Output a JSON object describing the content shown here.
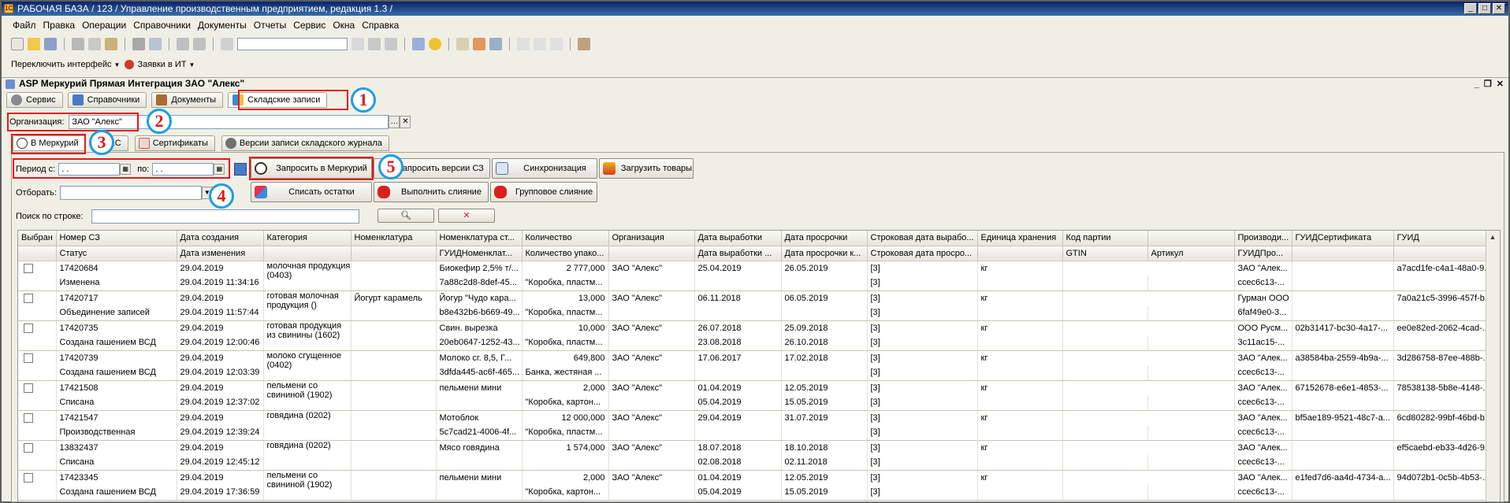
{
  "window": {
    "title": "РАБОЧАЯ БАЗА / 123 / Управление производственным предприятием, редакция 1.3 /"
  },
  "menu": [
    "Файл",
    "Правка",
    "Операции",
    "Справочники",
    "Документы",
    "Отчеты",
    "Сервис",
    "Окна",
    "Справка"
  ],
  "toolbar2": {
    "switch_interface": "Переключить интерфейс",
    "requests": "Заявки в ИТ"
  },
  "document": {
    "title": "ASP Меркурий Прямая Интеграция ЗАО \"Алекс\""
  },
  "section_tabs": [
    "Сервис",
    "Справочники",
    "Документы",
    "Складские записи"
  ],
  "org": {
    "label": "Организация:",
    "value": "ЗАО \"Алекс\""
  },
  "sub_tabs": [
    "В Меркурий",
    "1С",
    "Сертификаты",
    "Версии записи складского журнала"
  ],
  "filters": {
    "period_from_label": "Период с:",
    "period_from_value": ". .",
    "period_to_label": "по:",
    "period_to_value": ". .",
    "select_label": "Отборать:",
    "search_label": "Поиск по строке:"
  },
  "buttons": {
    "request_mercury": "Запросить в Меркурий",
    "request_versions": "Запросить версии СЗ",
    "sync": "Синхронизация",
    "load_goods": "Загрузить товары",
    "write_off": "Списать остатки",
    "merge": "Выполнить слияние",
    "group_merge": "Групповое слияние"
  },
  "annotations": [
    "1",
    "2",
    "3",
    "4",
    "5"
  ],
  "table": {
    "headers1": [
      "Выбран",
      "Номер СЗ",
      "Дата создания",
      "Категория",
      "Номенклатура",
      "Номенклатура ст...",
      "Количество",
      "Организация",
      "Дата выработки",
      "Дата просрочки",
      "Строковая дата вырабо...",
      "Единица хранения",
      "Код партии",
      "",
      "Производи...",
      "ГУИДСертификата",
      "ГУИД"
    ],
    "headers2": [
      "",
      "Статус",
      "Дата изменения",
      "",
      "",
      "ГУИДНоменклат...",
      "Количество упако...",
      "",
      "Дата выработки ...",
      "Дата просрочки к...",
      "Строковая дата просро...",
      "",
      "GTIN",
      "Артикул",
      "ГУИДПро...",
      "",
      ""
    ],
    "rows": [
      {
        "num": "17420684",
        "status": "Изменена",
        "created": "29.04.2019",
        "changed": "29.04.2019 11:34:16",
        "category": "молочная продукция (0403)",
        "nomen": "",
        "nomst": "Биокефир 2,5% т/...",
        "guidn": "7a88c2d8-8def-45...",
        "qty": "2 777,000",
        "pack": "\"Коробка, пластм...",
        "org": "ЗАО \"Алекс\"",
        "prod1": "25.04.2019",
        "prod2": "",
        "exp1": "26.05.2019",
        "exp2": "",
        "str1": "[3]",
        "str2": "[3]",
        "unit": "кг",
        "maker": "ЗАО \"Алек...",
        "guidp": "ccec6c13-...",
        "cert": "",
        "guid": "a7acd1fe-c4a1-48a0-9..."
      },
      {
        "num": "17420717",
        "status": "Объединение записей",
        "created": "29.04.2019",
        "changed": "29.04.2019 11:57:44",
        "category": "готовая молочная продукция ()",
        "nomen": "Йогурт карамель",
        "nomst": "Йогур \"Чудо кара...",
        "guidn": "b8e432b6-b669-49...",
        "qty": "13,000",
        "pack": "\"Коробка, пластм...",
        "org": "ЗАО \"Алекс\"",
        "prod1": "06.11.2018",
        "prod2": "",
        "exp1": "06.05.2019",
        "exp2": "",
        "str1": "[3]",
        "str2": "[3]",
        "unit": "кг",
        "maker": "Гурман ООО",
        "guidp": "6faf49e0-3...",
        "cert": "",
        "guid": "7a0a21c5-3996-457f-b..."
      },
      {
        "num": "17420735",
        "status": "Создана гашением ВСД",
        "created": "29.04.2019",
        "changed": "29.04.2019 12:00:46",
        "category": "готовая продукция из свинины (1602)",
        "nomen": "",
        "nomst": "Свин. вырезка",
        "guidn": "20eb0647-1252-43...",
        "qty": "10,000",
        "pack": "\"Коробка, пластм...",
        "org": "ЗАО \"Алекс\"",
        "prod1": "26.07.2018",
        "prod2": "23.08.2018",
        "exp1": "25.09.2018",
        "exp2": "26.10.2018",
        "str1": "[3]",
        "str2": "[3]",
        "unit": "кг",
        "maker": "ООО Русм...",
        "guidp": "3c11ac15-...",
        "cert": "02b31417-bc30-4a17-...",
        "guid": "ee0e82ed-2062-4cad-..."
      },
      {
        "num": "17420739",
        "status": "Создана гашением ВСД",
        "created": "29.04.2019",
        "changed": "29.04.2019 12:03:39",
        "category": "молоко сгущенное (0402)",
        "nomen": "",
        "nomst": "Молоко сг. 8,5, Г...",
        "guidn": "3dfda445-ac6f-465...",
        "qty": "649,800",
        "pack": "Банка, жестяная ...",
        "org": "ЗАО \"Алекс\"",
        "prod1": "17.06.2017",
        "prod2": "",
        "exp1": "17.02.2018",
        "exp2": "",
        "str1": "[3]",
        "str2": "[3]",
        "unit": "кг",
        "maker": "ЗАО \"Алек...",
        "guidp": "ccec6c13-...",
        "cert": "a38584ba-2559-4b9a-...",
        "guid": "3d286758-87ee-488b-..."
      },
      {
        "num": "17421508",
        "status": "Списана",
        "created": "29.04.2019",
        "changed": "29.04.2019 12:37:02",
        "category": "пельмени со свининой (1902)",
        "nomen": "",
        "nomst": "пельмени мини",
        "guidn": "",
        "qty": "2,000",
        "pack": "\"Коробка, картон...",
        "org": "ЗАО \"Алекс\"",
        "prod1": "01.04.2019",
        "prod2": "05.04.2019",
        "exp1": "12.05.2019",
        "exp2": "15.05.2019",
        "str1": "[3]",
        "str2": "[3]",
        "unit": "кг",
        "maker": "ЗАО \"Алек...",
        "guidp": "ccec6c13-...",
        "cert": "67152678-e6e1-4853-...",
        "guid": "78538138-5b8e-4148-..."
      },
      {
        "num": "17421547",
        "status": "Производственная",
        "created": "29.04.2019",
        "changed": "29.04.2019 12:39:24",
        "category": "говядина (0202)",
        "nomen": "",
        "nomst": "Мотоблок",
        "guidn": "5c7cad21-4006-4f...",
        "qty": "12 000,000",
        "pack": "\"Коробка, пластм...",
        "org": "ЗАО \"Алекс\"",
        "prod1": "29.04.2019",
        "prod2": "",
        "exp1": "31.07.2019",
        "exp2": "",
        "str1": "[3]",
        "str2": "[3]",
        "unit": "кг",
        "maker": "ЗАО \"Алек...",
        "guidp": "ccec6c13-...",
        "cert": "bf5ae189-9521-48c7-a...",
        "guid": "6cd80282-99bf-46bd-b..."
      },
      {
        "num": "13832437",
        "status": "Списана",
        "created": "29.04.2019",
        "changed": "29.04.2019 12:45:12",
        "category": "говядина (0202)",
        "nomen": "",
        "nomst": "Мясо говядина",
        "guidn": "",
        "qty": "1 574,000",
        "pack": "",
        "org": "ЗАО \"Алекс\"",
        "prod1": "18.07.2018",
        "prod2": "02.08.2018",
        "exp1": "18.10.2018",
        "exp2": "02.11.2018",
        "str1": "[3]",
        "str2": "[3]",
        "unit": "кг",
        "maker": "ЗАО \"Алек...",
        "guidp": "ccec6c13-...",
        "cert": "",
        "guid": "ef5caebd-eb33-4d26-9..."
      },
      {
        "num": "17423345",
        "status": "Создана гашением ВСД",
        "created": "29.04.2019",
        "changed": "29.04.2019 17:36:59",
        "category": "пельмени со свининой (1902)",
        "nomen": "",
        "nomst": "пельмени мини",
        "guidn": "",
        "qty": "2,000",
        "pack": "\"Коробка, картон...",
        "org": "ЗАО \"Алекс\"",
        "prod1": "01.04.2019",
        "prod2": "05.04.2019",
        "exp1": "12.05.2019",
        "exp2": "15.05.2019",
        "str1": "[3]",
        "str2": "[3]",
        "unit": "кг",
        "maker": "ЗАО \"Алек...",
        "guidp": "ccec6c13-...",
        "cert": "e1fed7d6-aa4d-4734-a...",
        "guid": "94d072b1-0c5b-4b53-..."
      }
    ]
  },
  "colors": {
    "highlight": "#e01a1a",
    "circle": "#1c9ee0",
    "titlebar": "#0a246a"
  }
}
